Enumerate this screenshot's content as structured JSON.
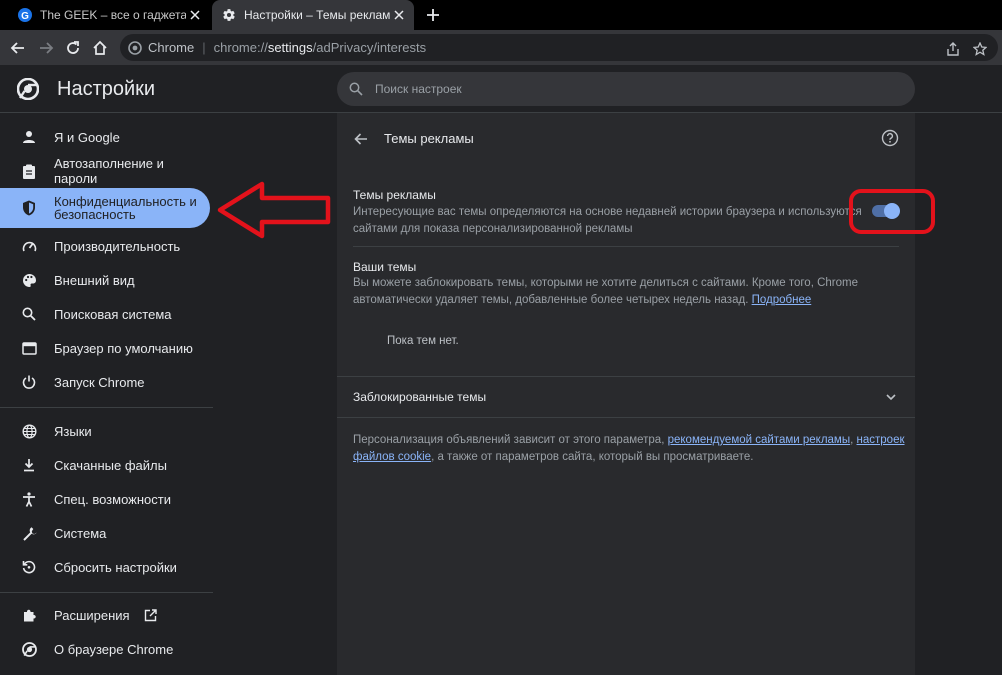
{
  "tabs": [
    {
      "title": "The GEEK – все о гаджетах, техн",
      "active": false,
      "icon": "geek-favicon"
    },
    {
      "title": "Настройки – Темы рекламы",
      "active": true,
      "icon": "gear-icon"
    }
  ],
  "omnibox": {
    "chip": "Chrome",
    "separator": "|",
    "url_prefix": "chrome://",
    "url_host": "settings",
    "url_path": "/adPrivacy/interests"
  },
  "header": {
    "title": "Настройки",
    "search_placeholder": "Поиск настроек"
  },
  "sidebar": {
    "items": [
      {
        "label": "Я и Google",
        "icon": "person-icon"
      },
      {
        "label": "Автозаполнение и пароли",
        "icon": "clipboard-icon"
      },
      {
        "label": "Конфиденциальность и\nбезопасность",
        "icon": "shield-icon",
        "active": true
      },
      {
        "label": "Производительность",
        "icon": "gauge-icon"
      },
      {
        "label": "Внешний вид",
        "icon": "palette-icon"
      },
      {
        "label": "Поисковая система",
        "icon": "search-icon"
      },
      {
        "label": "Браузер по умолчанию",
        "icon": "browser-icon"
      },
      {
        "label": "Запуск Chrome",
        "icon": "power-icon"
      },
      {
        "label": "Языки",
        "icon": "globe-icon"
      },
      {
        "label": "Скачанные файлы",
        "icon": "download-icon"
      },
      {
        "label": "Спец. возможности",
        "icon": "accessibility-icon"
      },
      {
        "label": "Система",
        "icon": "wrench-icon"
      },
      {
        "label": "Сбросить настройки",
        "icon": "reset-icon"
      },
      {
        "label": "Расширения",
        "icon": "puzzle-icon"
      },
      {
        "label": "О браузере Chrome",
        "icon": "chrome-icon"
      }
    ]
  },
  "content": {
    "page_title": "Темы рекламы",
    "ad_topics": {
      "title": "Темы рекламы",
      "desc_line1": "Интересующие вас темы определяются на основе недавней истории браузера и используются",
      "desc_line2": "сайтами для показа персонализированной рекламы",
      "enabled": true
    },
    "your_topics": {
      "title": "Ваши темы",
      "desc_line1": "Вы можете заблокировать темы, которыми не хотите делиться с сайтами. Кроме того, Chrome",
      "desc_line2": "автоматически удаляет темы, добавленные более четырех недель назад.",
      "link": "Подробнее",
      "empty": "Пока тем нет."
    },
    "blocked": {
      "title": "Заблокированные темы"
    },
    "footer": {
      "text1": "Персонализация объявлений зависит от этого параметра,",
      "link1": "рекомендуемой сайтами рекламы",
      "sep": ",",
      "link2a": "настроек",
      "link2b": "файлов cookie",
      "text2": ", а также от параметров сайта, который вы просматриваете."
    }
  },
  "colors": {
    "accent": "#8ab4f8",
    "annotation": "#e3121b",
    "background": "#202124",
    "panel": "#292a2d"
  }
}
